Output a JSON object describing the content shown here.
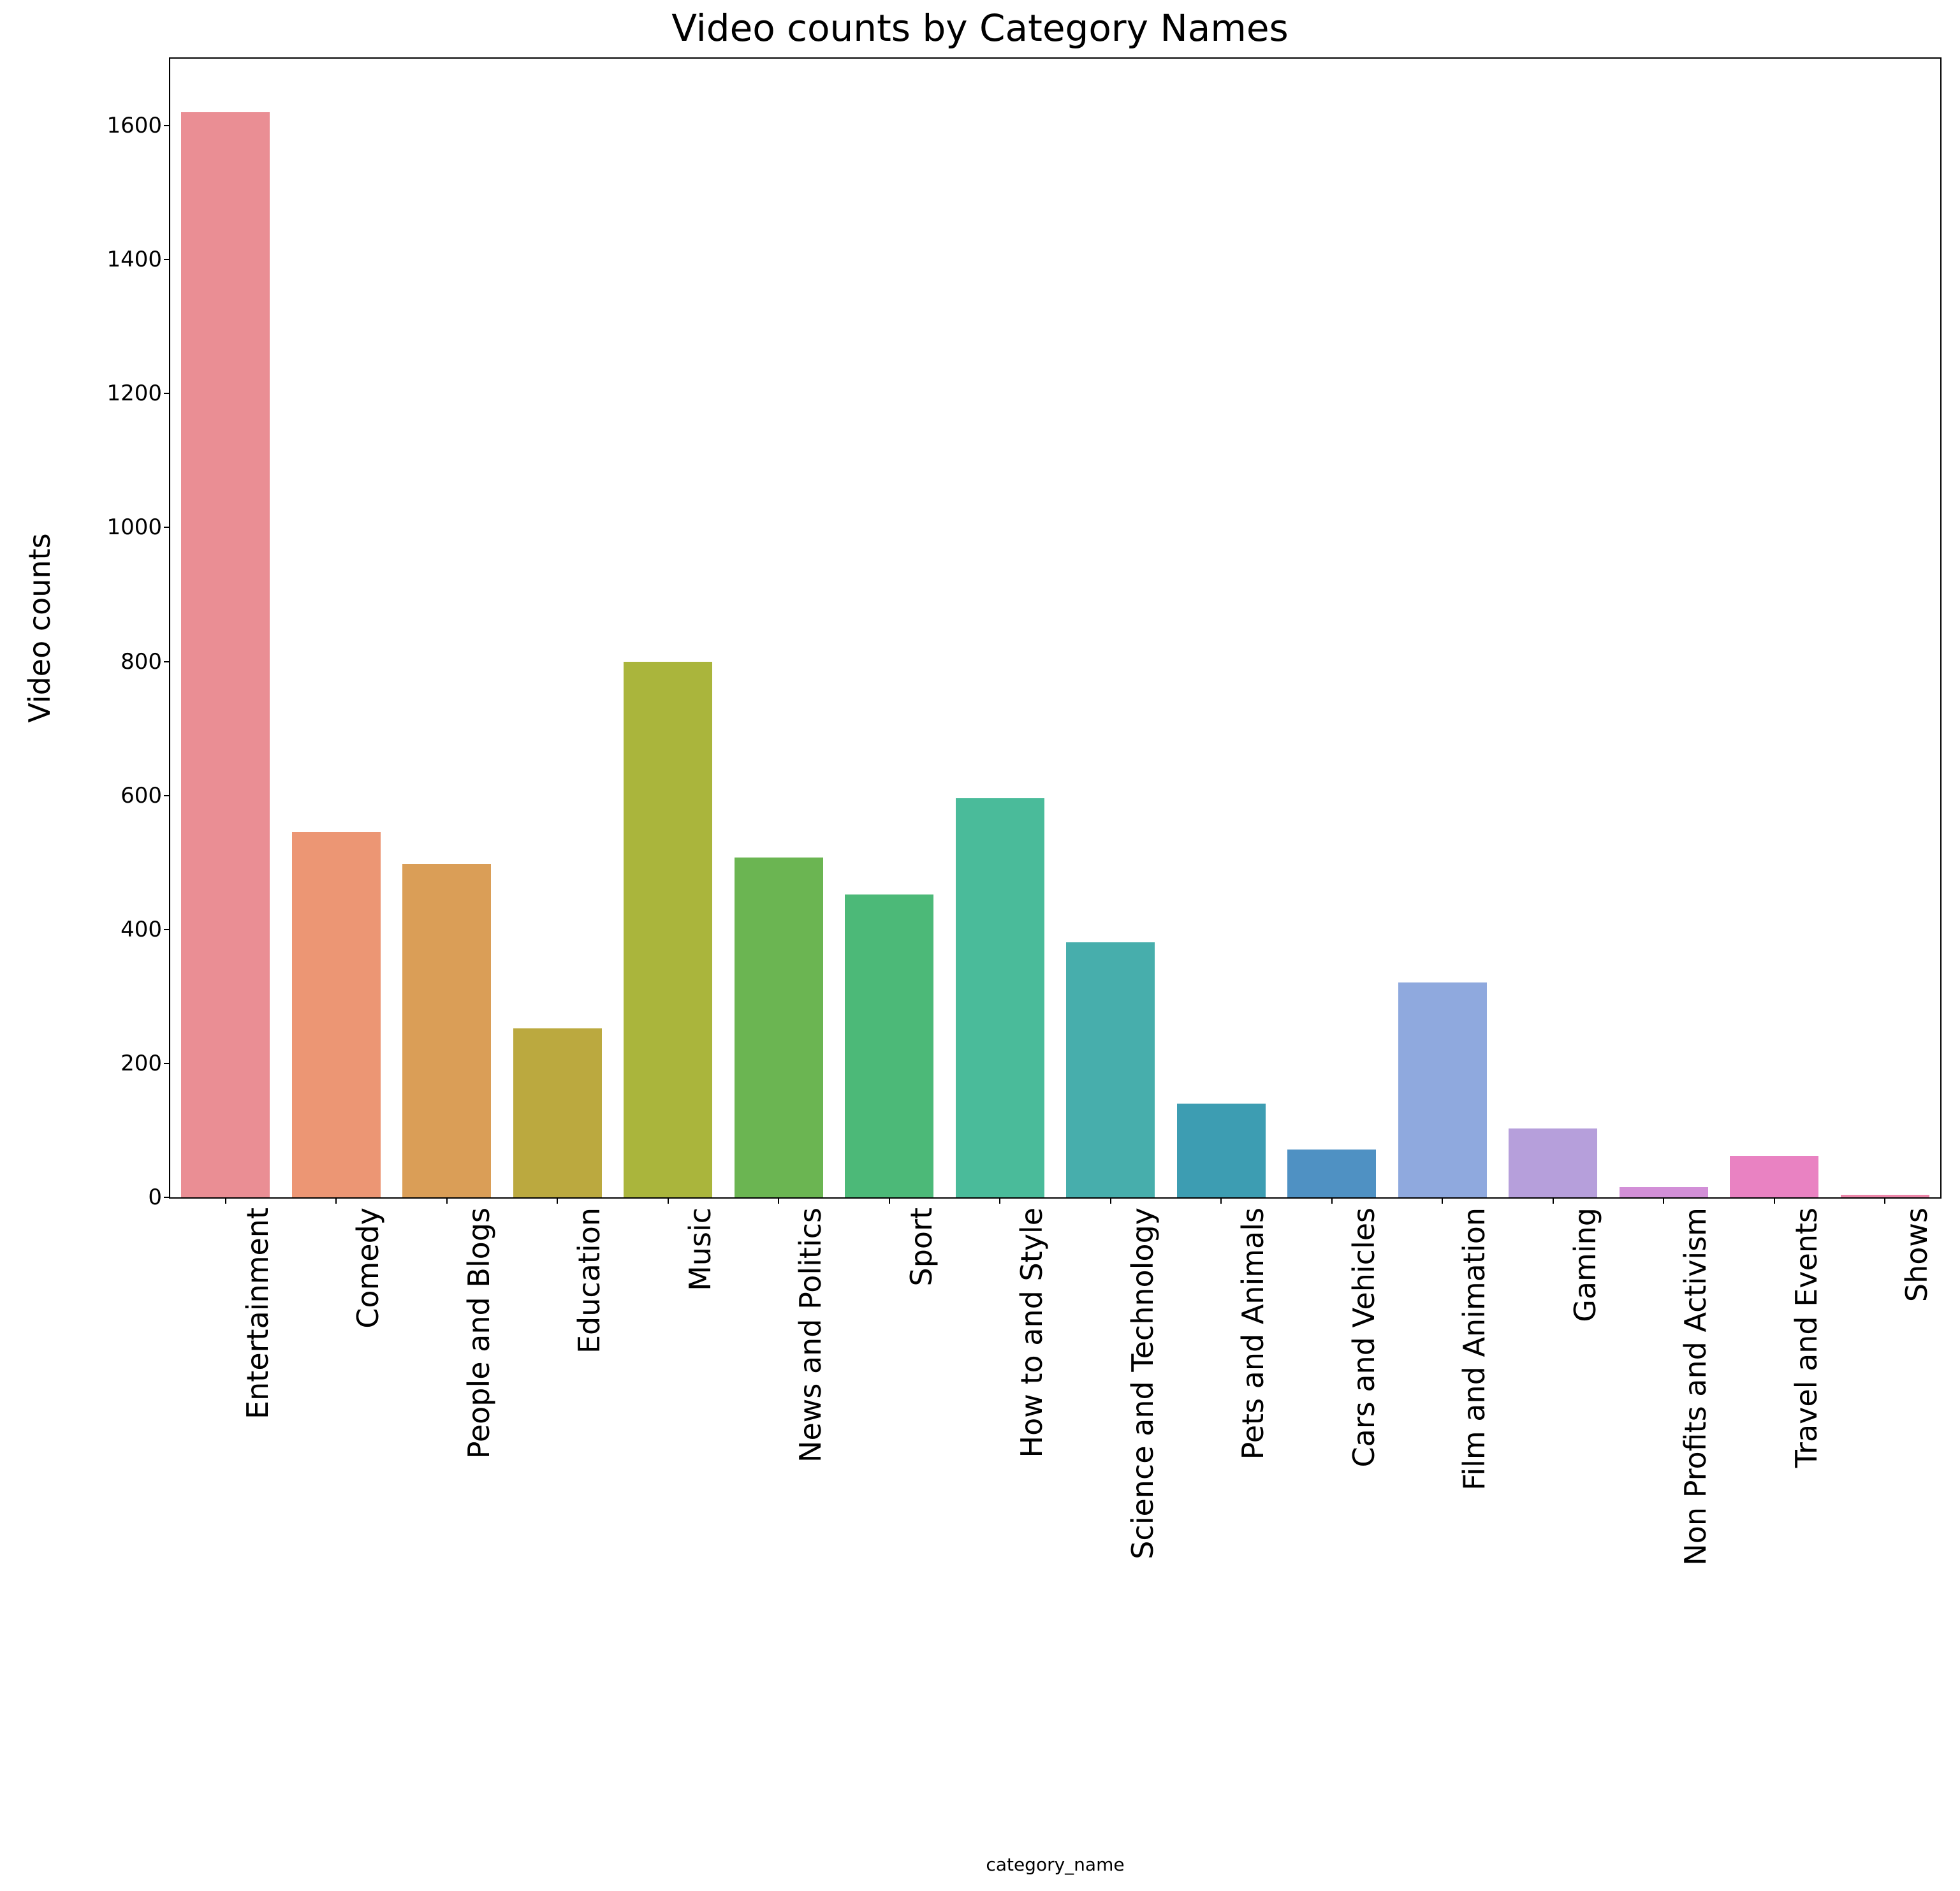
{
  "chart_data": {
    "type": "bar",
    "title": "Video counts by Category Names",
    "ylabel": "Video counts",
    "xlabel": "category_name",
    "ylim": [
      0,
      1700
    ],
    "yticks": [
      0,
      200,
      400,
      600,
      800,
      1000,
      1200,
      1400,
      1600
    ],
    "categories": [
      "Entertainment",
      "Comedy",
      "People and Blogs",
      "Education",
      "Music",
      "News and Politics",
      "Sport",
      "How to and Style",
      "Science and Technology",
      "Pets and Animals",
      "Cars and Vehicles",
      "Film and Animation",
      "Gaming",
      "Non Profits and Activism",
      "Travel and Events",
      "Shows"
    ],
    "values": [
      1620,
      545,
      498,
      252,
      800,
      507,
      452,
      596,
      381,
      140,
      71,
      321,
      103,
      15,
      62,
      4
    ],
    "colors": [
      "#ea8e94",
      "#ec9674",
      "#da9e57",
      "#bba93f",
      "#aab53c",
      "#6bb552",
      "#4cb978",
      "#4abb9a",
      "#47aeac",
      "#3d9db2",
      "#4f91c3",
      "#8fa9de",
      "#b69fdb",
      "#d28fd7",
      "#e982c2",
      "#ec86a9"
    ]
  }
}
